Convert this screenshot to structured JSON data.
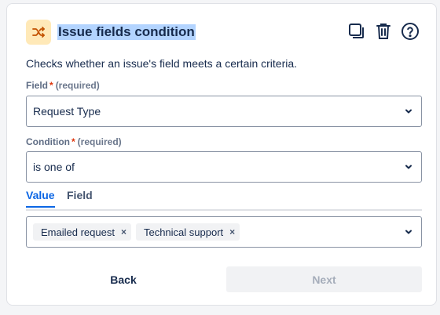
{
  "header": {
    "title": "Issue fields condition",
    "icons": [
      "shuffle-icon",
      "duplicate-icon",
      "trash-icon",
      "help-icon"
    ]
  },
  "description": "Checks whether an issue's field meets a certain criteria.",
  "field": {
    "label": "Field",
    "required_mark": "*",
    "required_text": "(required)",
    "value": "Request Type"
  },
  "condition": {
    "label": "Condition",
    "required_mark": "*",
    "required_text": "(required)",
    "value": "is one of"
  },
  "tabs": [
    {
      "label": "Value",
      "active": true
    },
    {
      "label": "Field",
      "active": false
    }
  ],
  "values": {
    "chips": [
      {
        "label": "Emailed request",
        "remove": "×"
      },
      {
        "label": "Technical support",
        "remove": "×"
      }
    ]
  },
  "buttons": {
    "back": "Back",
    "next": "Next"
  },
  "colors": {
    "accent": "#0c66e4",
    "required": "#de350b",
    "title_highlight": "#b3d4ff",
    "icon_bg": "#ffe9b8",
    "icon_fg": "#c25100"
  }
}
